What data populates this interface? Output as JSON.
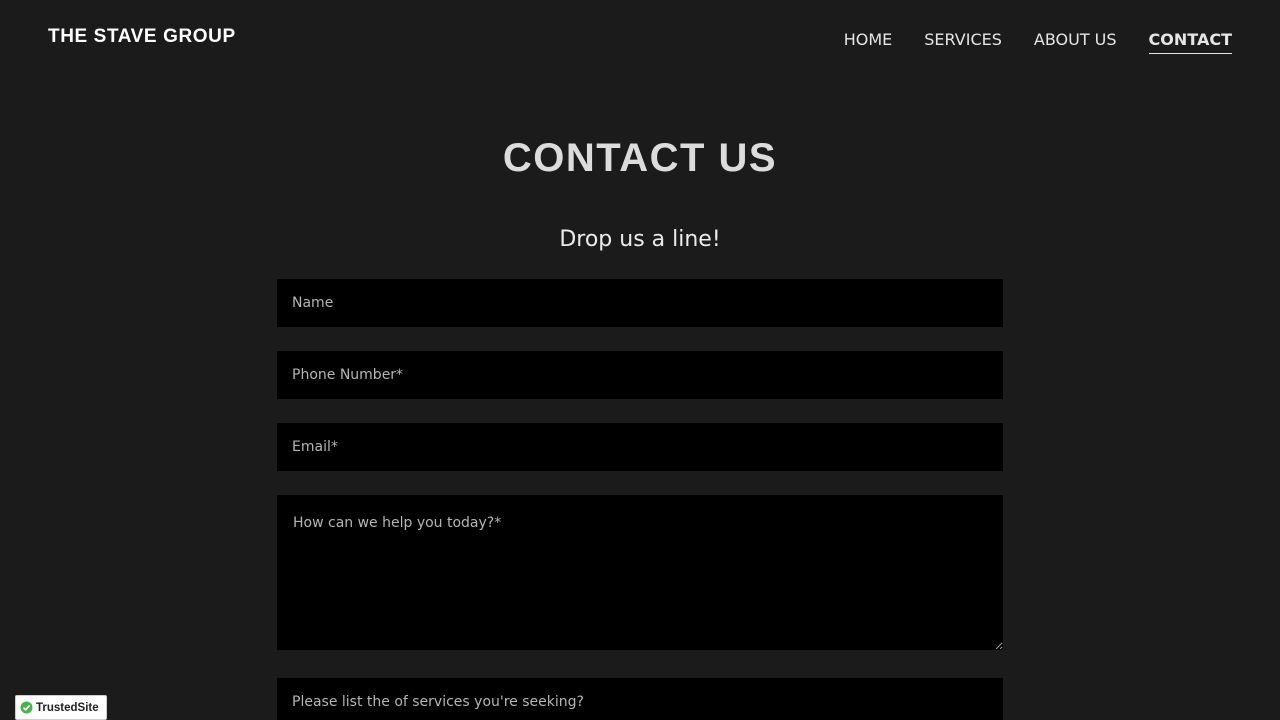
{
  "header": {
    "logo": "THE STAVE GROUP",
    "nav": [
      {
        "label": "HOME",
        "active": false
      },
      {
        "label": "SERVICES",
        "active": false
      },
      {
        "label": "ABOUT US",
        "active": false
      },
      {
        "label": "CONTACT",
        "active": true
      }
    ]
  },
  "main": {
    "title": "CONTACT US",
    "subtitle": "Drop us a line!",
    "form": {
      "name_placeholder": "Name",
      "phone_placeholder": "Phone Number*",
      "email_placeholder": "Email*",
      "message_placeholder": "How can we help you today?*",
      "services_placeholder": "Please list the of services you're seeking?"
    }
  },
  "badge": {
    "label": "TrustedSite",
    "icon": "check-circle-icon",
    "color": "#4caf50"
  },
  "colors": {
    "background": "#1b1b1b",
    "field_background": "#000000",
    "text": "#e6e6e6"
  }
}
